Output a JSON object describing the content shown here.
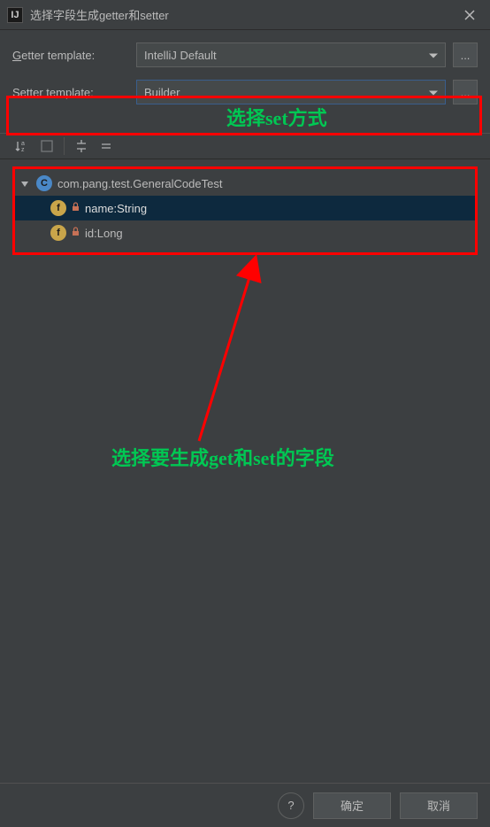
{
  "window": {
    "title": "选择字段生成getter和setter",
    "app_icon_text": "IJ"
  },
  "getter": {
    "label_prefix": "G",
    "label_rest": "etter template:",
    "value": "IntelliJ Default"
  },
  "setter": {
    "label_prefix": "S",
    "label_rest": "etter template:",
    "value": "Builder"
  },
  "annotations": {
    "select_set": "选择set方式",
    "select_fields": "选择要生成get和set的字段"
  },
  "tree": {
    "class": "com.pang.test.GeneralCodeTest",
    "fields": [
      {
        "label": "name:String",
        "selected": true
      },
      {
        "label": "id:Long",
        "selected": false
      }
    ]
  },
  "footer": {
    "ok": "确定",
    "cancel": "取消"
  },
  "icons": {
    "class_letter": "C",
    "field_letter": "f",
    "help": "?"
  }
}
